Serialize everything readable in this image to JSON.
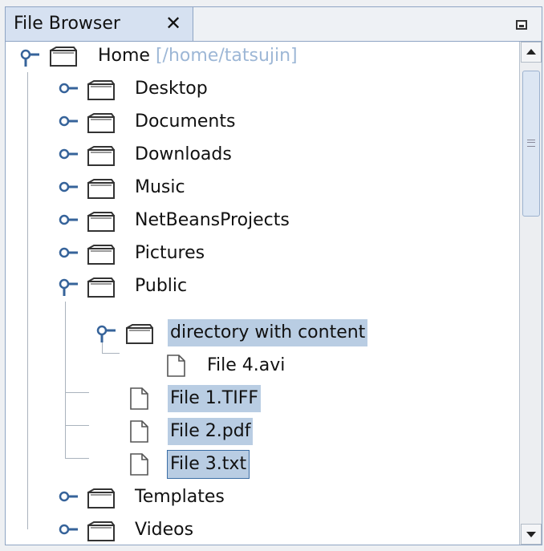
{
  "tab": {
    "title": "File Browser",
    "close_glyph": "✕"
  },
  "tree": {
    "root": {
      "label": "Home",
      "path": "[/home/tatsujin]"
    },
    "items": [
      {
        "label": "Desktop",
        "type": "folder",
        "expanded": false,
        "selected": false
      },
      {
        "label": "Documents",
        "type": "folder",
        "expanded": false,
        "selected": false
      },
      {
        "label": "Downloads",
        "type": "folder",
        "expanded": false,
        "selected": false
      },
      {
        "label": "Music",
        "type": "folder",
        "expanded": false,
        "selected": false
      },
      {
        "label": "NetBeansProjects",
        "type": "folder",
        "expanded": false,
        "selected": false
      },
      {
        "label": "Pictures",
        "type": "folder",
        "expanded": false,
        "selected": false
      },
      {
        "label": "Public",
        "type": "folder",
        "expanded": true,
        "selected": false
      },
      {
        "label": "directory with content",
        "type": "folder",
        "expanded": true,
        "selected": true
      },
      {
        "label": "File 4.avi",
        "type": "file",
        "selected": false
      },
      {
        "label": "File 1.TIFF",
        "type": "file",
        "selected": true
      },
      {
        "label": "File 2.pdf",
        "type": "file",
        "selected": true
      },
      {
        "label": "File 3.txt",
        "type": "file",
        "selected": true,
        "focused": true
      },
      {
        "label": "Templates",
        "type": "folder",
        "expanded": false,
        "selected": false
      },
      {
        "label": "Videos",
        "type": "folder",
        "expanded": false,
        "selected": false
      }
    ]
  },
  "icons": {
    "folder": "folder-icon",
    "file": "file-icon",
    "expand_collapse": "tree-handle-icon",
    "minimize": "minimize-icon",
    "scroll_up": "arrow-up-icon",
    "scroll_down": "arrow-down-icon"
  },
  "colors": {
    "selection": "#b9cde3",
    "tab_active": "#d6e1f1",
    "path_text": "#9db7d6",
    "border": "#8fa5c4"
  }
}
